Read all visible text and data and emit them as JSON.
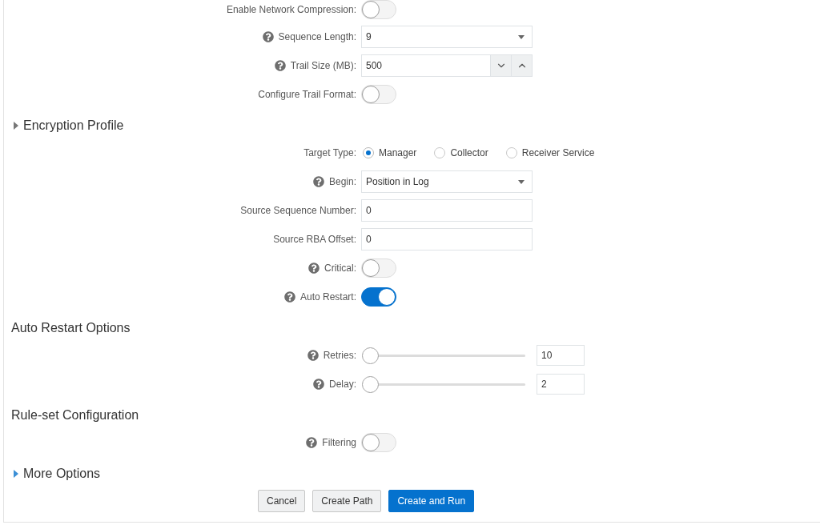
{
  "form": [
    {
      "kind": "toggle",
      "label": "Enable Network Compression:",
      "help": false,
      "on": false
    },
    {
      "kind": "select",
      "label": "Sequence Length:",
      "help": true,
      "value": "9"
    },
    {
      "kind": "spinner",
      "label": "Trail Size (MB):",
      "help": true,
      "value": "500"
    },
    {
      "kind": "toggle",
      "label": "Configure Trail Format:",
      "help": false,
      "on": false
    },
    {
      "kind": "section",
      "title": "Encryption Profile",
      "expanded": false,
      "highlighted": false
    },
    {
      "kind": "radio",
      "label": "Target Type:",
      "help": false,
      "options": [
        {
          "label": "Manager",
          "selected": true
        },
        {
          "label": "Collector",
          "selected": false
        },
        {
          "label": "Receiver Service",
          "selected": false
        }
      ]
    },
    {
      "kind": "select",
      "label": "Begin:",
      "help": true,
      "value": "Position in Log"
    },
    {
      "kind": "text",
      "label": "Source Sequence Number:",
      "help": false,
      "value": "0"
    },
    {
      "kind": "text",
      "label": "Source RBA Offset:",
      "help": false,
      "value": "0"
    },
    {
      "kind": "toggle",
      "label": "Critical:",
      "help": true,
      "on": false
    },
    {
      "kind": "toggle",
      "label": "Auto Restart:",
      "help": true,
      "on": true
    },
    {
      "kind": "section",
      "title": "Auto Restart Options"
    },
    {
      "kind": "slider",
      "label": "Retries:",
      "help": true,
      "level": 0,
      "value": "10"
    },
    {
      "kind": "slider",
      "label": "Delay:",
      "help": true,
      "level": 0,
      "value": "2"
    },
    {
      "kind": "section",
      "title": "Rule-set Configuration"
    },
    {
      "kind": "toggle",
      "label": "Filtering",
      "help": true,
      "on": false
    },
    {
      "kind": "section",
      "title": "More Options",
      "expanded": false,
      "highlighted": true
    }
  ],
  "buttons": [
    {
      "label": "Cancel",
      "kind": "secondary"
    },
    {
      "label": "Create Path",
      "kind": "secondary"
    },
    {
      "label": "Create and Run",
      "kind": "primary"
    }
  ]
}
